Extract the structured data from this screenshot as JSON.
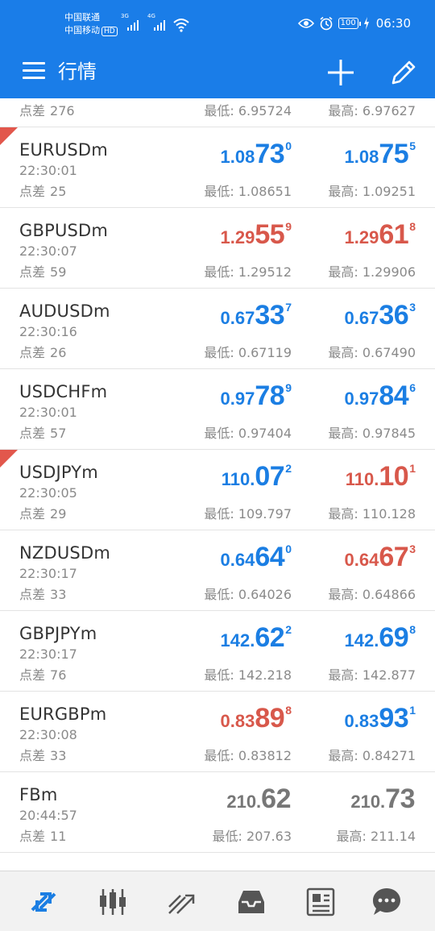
{
  "status_bar": {
    "carrier_1": "中国联通",
    "carrier_2": "中国移动",
    "hd_badge": "HD",
    "sig1_label": "3G",
    "sig2_label": "4G",
    "battery": "100",
    "time": "06:30",
    "icons": [
      "eye-icon",
      "alarm-icon",
      "battery-icon",
      "charging-icon",
      "wifi-icon",
      "signal-icon"
    ]
  },
  "app_bar": {
    "title": "行情",
    "icons": [
      "menu-icon",
      "add-icon",
      "edit-icon"
    ]
  },
  "labels": {
    "spread": "点差",
    "low": "最低:",
    "high": "最高:"
  },
  "colors": {
    "header": "#1a7de8",
    "up": "#1b7ee3",
    "down": "#d8584b",
    "flat": "#777777"
  },
  "partial_top_row": {
    "spread": "276",
    "low": "6.95724",
    "high": "6.97627"
  },
  "quotes": [
    {
      "symbol": "EURUSDm",
      "time": "22:30:01",
      "spread": "25",
      "flag": true,
      "bid": {
        "pre": "1.08",
        "big": "73",
        "sup": "0",
        "dir": "up"
      },
      "ask": {
        "pre": "1.08",
        "big": "75",
        "sup": "5",
        "dir": "up"
      },
      "low": "1.08651",
      "high": "1.09251"
    },
    {
      "symbol": "GBPUSDm",
      "time": "22:30:07",
      "spread": "59",
      "flag": false,
      "bid": {
        "pre": "1.29",
        "big": "55",
        "sup": "9",
        "dir": "down"
      },
      "ask": {
        "pre": "1.29",
        "big": "61",
        "sup": "8",
        "dir": "down"
      },
      "low": "1.29512",
      "high": "1.29906"
    },
    {
      "symbol": "AUDUSDm",
      "time": "22:30:16",
      "spread": "26",
      "flag": false,
      "bid": {
        "pre": "0.67",
        "big": "33",
        "sup": "7",
        "dir": "up"
      },
      "ask": {
        "pre": "0.67",
        "big": "36",
        "sup": "3",
        "dir": "up"
      },
      "low": "0.67119",
      "high": "0.67490"
    },
    {
      "symbol": "USDCHFm",
      "time": "22:30:01",
      "spread": "57",
      "flag": false,
      "bid": {
        "pre": "0.97",
        "big": "78",
        "sup": "9",
        "dir": "up"
      },
      "ask": {
        "pre": "0.97",
        "big": "84",
        "sup": "6",
        "dir": "up"
      },
      "low": "0.97404",
      "high": "0.97845"
    },
    {
      "symbol": "USDJPYm",
      "time": "22:30:05",
      "spread": "29",
      "flag": true,
      "bid": {
        "pre": "110.",
        "big": "07",
        "sup": "2",
        "dir": "up"
      },
      "ask": {
        "pre": "110.",
        "big": "10",
        "sup": "1",
        "dir": "down"
      },
      "low": "109.797",
      "high": "110.128"
    },
    {
      "symbol": "NZDUSDm",
      "time": "22:30:17",
      "spread": "33",
      "flag": false,
      "bid": {
        "pre": "0.64",
        "big": "64",
        "sup": "0",
        "dir": "up"
      },
      "ask": {
        "pre": "0.64",
        "big": "67",
        "sup": "3",
        "dir": "down"
      },
      "low": "0.64026",
      "high": "0.64866"
    },
    {
      "symbol": "GBPJPYm",
      "time": "22:30:17",
      "spread": "76",
      "flag": false,
      "bid": {
        "pre": "142.",
        "big": "62",
        "sup": "2",
        "dir": "up"
      },
      "ask": {
        "pre": "142.",
        "big": "69",
        "sup": "8",
        "dir": "up"
      },
      "low": "142.218",
      "high": "142.877"
    },
    {
      "symbol": "EURGBPm",
      "time": "22:30:08",
      "spread": "33",
      "flag": false,
      "bid": {
        "pre": "0.83",
        "big": "89",
        "sup": "8",
        "dir": "down"
      },
      "ask": {
        "pre": "0.83",
        "big": "93",
        "sup": "1",
        "dir": "up"
      },
      "low": "0.83812",
      "high": "0.84271"
    },
    {
      "symbol": "FBm",
      "time": "20:44:57",
      "spread": "11",
      "flag": false,
      "bid": {
        "pre": "210.",
        "big": "62",
        "sup": "",
        "dir": "flat"
      },
      "ask": {
        "pre": "210.",
        "big": "73",
        "sup": "",
        "dir": "flat"
      },
      "low": "207.63",
      "high": "211.14"
    }
  ],
  "bottom_nav": {
    "items": [
      "quotes-icon",
      "chart-icon",
      "trade-icon",
      "history-icon",
      "news-icon",
      "chat-icon"
    ],
    "active": "quotes-icon"
  }
}
